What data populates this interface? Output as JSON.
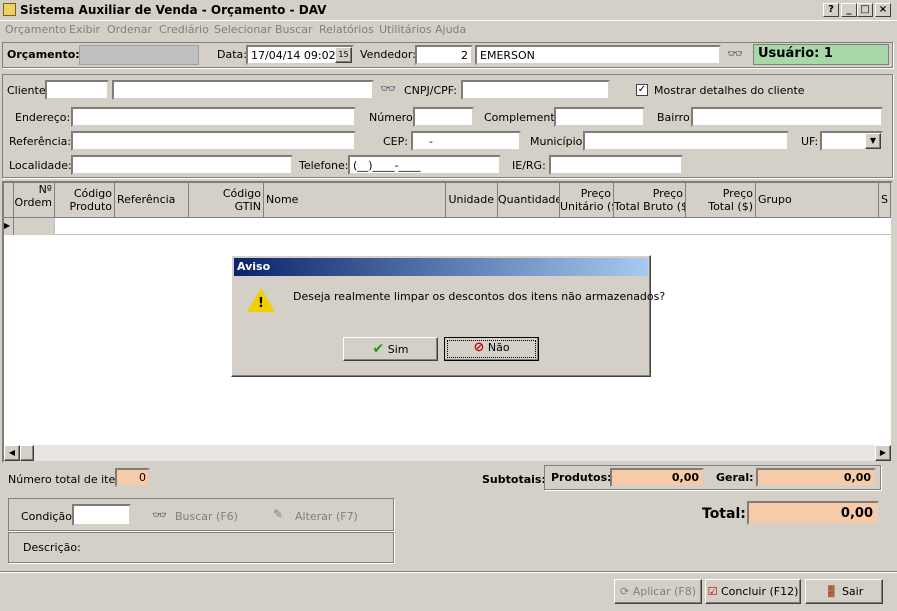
{
  "window": {
    "title": "Sistema Auxiliar de Venda - Orçamento - DAV",
    "help_btn": "?",
    "min_btn": "_",
    "max_btn": "□",
    "close_btn": "×"
  },
  "menu": [
    "Orçamento",
    "Exibir",
    "Ordenar",
    "Crediário",
    "Selecionar",
    "Buscar",
    "Relatórios",
    "Utilitários",
    "Ajuda"
  ],
  "header": {
    "orcamento_label": "Orçamento:",
    "data_label": "Data:",
    "data_value": "17/04/14 09:02",
    "calendar_icon_text": "15",
    "vendedor_label": "Vendedor:",
    "vendedor_code": "2",
    "vendedor_name": "EMERSON",
    "usuario": "Usuário: 1"
  },
  "client": {
    "cliente_label": "Cliente:",
    "cnpj_label": "CNPJ/CPF:",
    "mostrar_label": "Mostrar detalhes do cliente",
    "mostrar_checked": true,
    "endereco_label": "Endereço:",
    "numero_label": "Número:",
    "complemento_label": "Complemento:",
    "bairro_label": "Bairro:",
    "referencia_label": "Referência:",
    "cep_label": "CEP:",
    "cep_value": "-",
    "municipio_label": "Município:",
    "uf_label": "UF:",
    "localidade_label": "Localidade:",
    "telefone_label": "Telefone:",
    "telefone_value": "(__)____-____",
    "ie_label": "IE/RG:"
  },
  "grid": {
    "columns": [
      {
        "l1": "Nº",
        "l2": "Ordem"
      },
      {
        "l1": "Código",
        "l2": "Produto"
      },
      {
        "l1": "Referência",
        "l2": ""
      },
      {
        "l1": "Código",
        "l2": "GTIN"
      },
      {
        "l1": "Nome",
        "l2": ""
      },
      {
        "l1": "Unidade",
        "l2": ""
      },
      {
        "l1": "Quantidade",
        "l2": ""
      },
      {
        "l1": "Preço",
        "l2": "Unitário ($)"
      },
      {
        "l1": "Preço",
        "l2": "Total Bruto ($)"
      },
      {
        "l1": "Preço",
        "l2": "Total ($)"
      },
      {
        "l1": "Grupo",
        "l2": ""
      },
      {
        "l1": "S",
        "l2": ""
      }
    ]
  },
  "dialog": {
    "title": "Aviso",
    "message": "Deseja realmente limpar os descontos dos itens não armazenados?",
    "yes_label": "Sim",
    "no_label": "Não"
  },
  "footer": {
    "total_itens_label": "Número total de itens:",
    "total_itens_value": "0",
    "subtotais_label": "Subtotais:",
    "produtos_label": "Produtos:",
    "produtos_value": "0,00",
    "geral_label": "Geral:",
    "geral_value": "0,00",
    "condicao_label": "Condição:",
    "buscar_label": "Buscar (F6)",
    "alterar_label": "Alterar (F7)",
    "descricao_label": "Descrição:",
    "total_label": "Total:",
    "total_value": "0,00",
    "aplicar_label": "Aplicar (F8)",
    "concluir_label": "Concluir (F12)",
    "sair_label": "Sair"
  },
  "colors": {
    "user_bg": "#a8d8a8",
    "amount_bg": "#f8cba8",
    "dialog_title_from": "#0a246a",
    "dialog_title_to": "#a6caf0"
  }
}
